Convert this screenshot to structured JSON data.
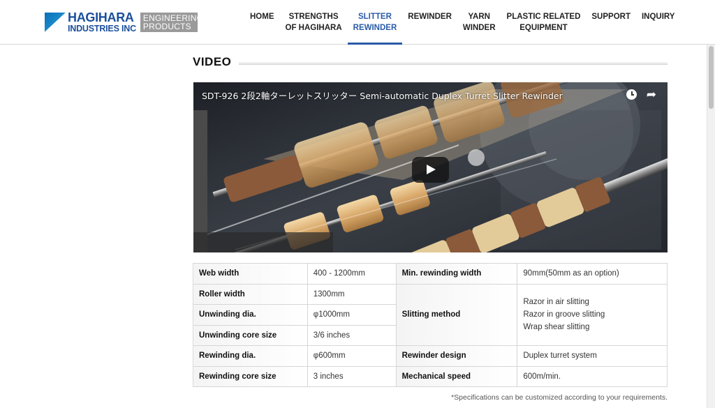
{
  "brand": {
    "name": "HAGIHARA",
    "sub": "INDUSTRIES INC",
    "badge_line1": "ENGINEERING",
    "badge_line2": "PRODUCTS",
    "color": "#1a4f9c"
  },
  "nav": {
    "items": [
      {
        "line1": "HOME",
        "line2": ""
      },
      {
        "line1": "STRENGTHS",
        "line2": "OF HAGIHARA"
      },
      {
        "line1": "SLITTER",
        "line2": "REWINDER",
        "active": true
      },
      {
        "line1": "REWINDER",
        "line2": ""
      },
      {
        "line1": "YARN",
        "line2": "WINDER"
      },
      {
        "line1": "PLASTIC RELATED",
        "line2": "EQUIPMENT"
      },
      {
        "line1": "SUPPORT",
        "line2": ""
      },
      {
        "line1": "INQUIRY",
        "line2": ""
      }
    ],
    "active_color": "#2a5ba8"
  },
  "section": {
    "title": "VIDEO"
  },
  "video": {
    "title": "SDT-926 2段2軸ターレットスリッター Semi-automatic Duplex Turret Slitter Rewinder",
    "icons": [
      "clock-icon",
      "share-icon",
      "play-icon"
    ]
  },
  "specs": {
    "left": [
      {
        "label": "Web width",
        "value": "400 - 1200mm"
      },
      {
        "label": "Roller width",
        "value": "1300mm"
      },
      {
        "label": "Unwinding dia.",
        "value": "φ1000mm"
      },
      {
        "label": "Unwinding core size",
        "value": "3/6 inches"
      },
      {
        "label": "Rewinding dia.",
        "value": "φ600mm"
      },
      {
        "label": "Rewinding core size",
        "value": "3 inches"
      }
    ],
    "right": {
      "min_rewinding_label": "Min. rewinding width",
      "min_rewinding_value": "90mm(50mm as an option)",
      "slitting_label": "Slitting method",
      "slitting_values": [
        "Razor in air slitting",
        "Razor in groove slitting",
        "Wrap shear slitting"
      ],
      "design_label": "Rewinder design",
      "design_value": "Duplex turret system",
      "speed_label": "Mechanical speed",
      "speed_value": "600m/min."
    }
  },
  "footnote": "*Specifications can be customized according to your requirements."
}
